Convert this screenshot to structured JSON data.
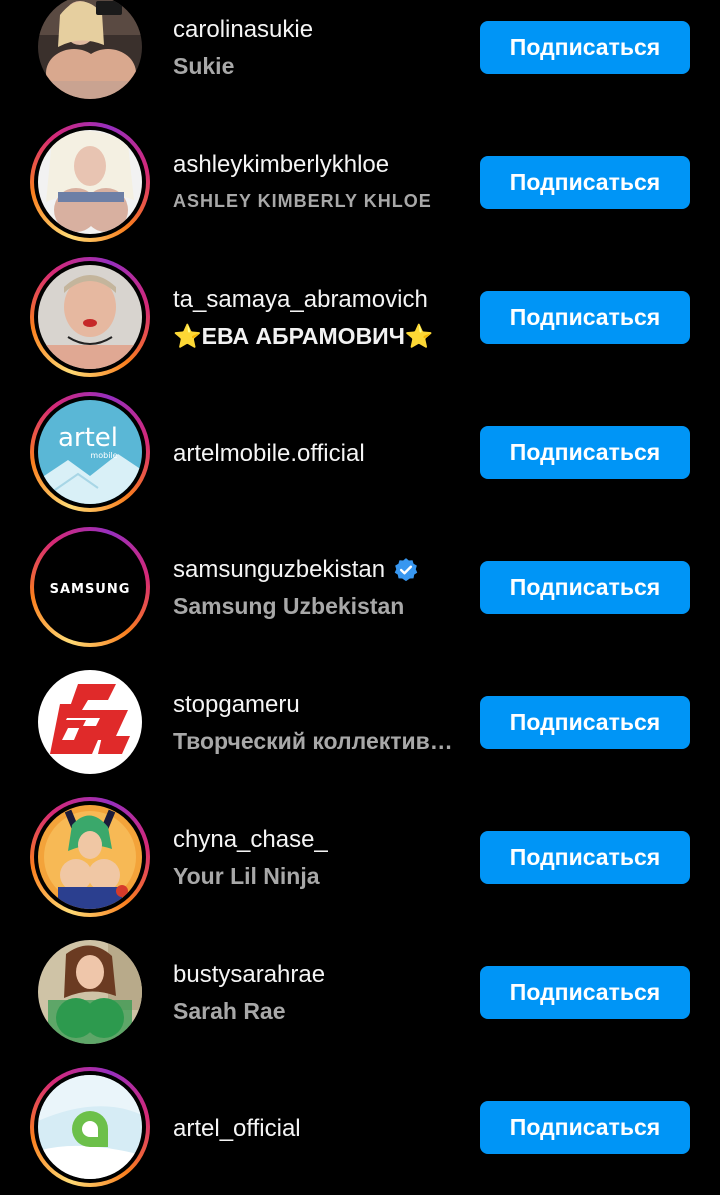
{
  "follow_label": "Подписаться",
  "accounts": [
    {
      "username": "carolinasukie",
      "full_name": "Sukie",
      "verified": false,
      "story_ring": false
    },
    {
      "username": "ashleykimberlykhloe",
      "full_name": "ASHLEY KIMBERLY KHLOE",
      "verified": false,
      "story_ring": true
    },
    {
      "username": "ta_samaya_abramovich",
      "full_name": "⭐ЕВА АБРАМОВИЧ⭐",
      "verified": false,
      "story_ring": true
    },
    {
      "username": "artelmobile.official",
      "full_name": "",
      "verified": false,
      "story_ring": true,
      "avatar_text": "artel",
      "avatar_subtext": "mobile"
    },
    {
      "username": "samsunguzbekistan",
      "full_name": "Samsung Uzbekistan",
      "verified": true,
      "story_ring": true,
      "avatar_text": "SAMSUNG"
    },
    {
      "username": "stopgameru",
      "full_name": "Творческий коллектив StopGame",
      "verified": false,
      "story_ring": false
    },
    {
      "username": "chyna_chase_",
      "full_name": "Your Lil Ninja",
      "verified": false,
      "story_ring": true
    },
    {
      "username": "bustysarahrae",
      "full_name": "Sarah Rae",
      "verified": false,
      "story_ring": false
    },
    {
      "username": "artel_official",
      "full_name": "",
      "verified": false,
      "story_ring": true
    }
  ],
  "colors": {
    "background": "#000000",
    "button": "#0095f6",
    "verified_badge": "#3897f0",
    "secondary_text": "#a8a8a8"
  }
}
